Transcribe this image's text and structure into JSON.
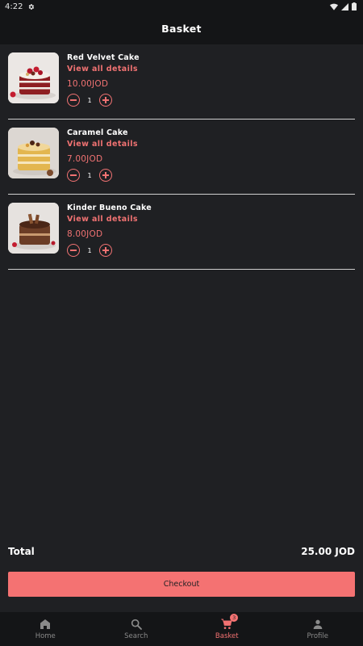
{
  "status_bar": {
    "time": "4:22"
  },
  "header": {
    "title": "Basket"
  },
  "basket": {
    "items": [
      {
        "name": "Red Velvet Cake",
        "details_label": "View all details",
        "price": "10.00JOD",
        "quantity": "1"
      },
      {
        "name": "Caramel Cake",
        "details_label": "View all details",
        "price": "7.00JOD",
        "quantity": "1"
      },
      {
        "name": "Kinder Bueno Cake",
        "details_label": "View all details",
        "price": "8.00JOD",
        "quantity": "1"
      }
    ]
  },
  "summary": {
    "total_label": "Total",
    "total_value": "25.00 JOD",
    "checkout_label": "Checkout"
  },
  "nav": {
    "items": [
      {
        "label": "Home",
        "icon": "home-icon"
      },
      {
        "label": "Search",
        "icon": "search-icon"
      },
      {
        "label": "Basket",
        "icon": "cart-icon",
        "badge": "3"
      },
      {
        "label": "Profile",
        "icon": "person-icon"
      }
    ]
  },
  "colors": {
    "accent": "#f47272",
    "background": "#1f2023",
    "bar": "#141517"
  }
}
